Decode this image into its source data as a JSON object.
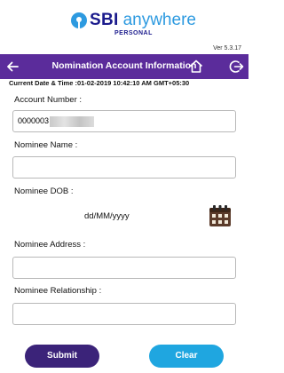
{
  "brand": {
    "sbi": "SBI",
    "anywhere": "anywhere",
    "personal": "PERSONAL"
  },
  "version": "Ver 5.3.17",
  "titlebar": {
    "title": "Nomination Account Information"
  },
  "datetime": "Current Date & Time :01-02-2019 10:42:10 AM GMT+05:30",
  "form": {
    "account_label": "Account Number :",
    "account_value": "0000003",
    "nominee_name_label": "Nominee Name :",
    "nominee_name_value": "",
    "nominee_dob_label": "Nominee DOB :",
    "nominee_dob_placeholder": "dd/MM/yyyy",
    "nominee_address_label": "Nominee Address :",
    "nominee_address_value": "",
    "nominee_relationship_label": "Nominee Relationship :",
    "nominee_relationship_value": ""
  },
  "buttons": {
    "submit": "Submit",
    "clear": "Clear"
  },
  "colors": {
    "header": "#5b2c9b",
    "submit": "#3b2379",
    "clear": "#1fa6e0",
    "brand_blue": "#2d9ae0",
    "brand_navy": "#1a1a8c"
  },
  "icons": {
    "back": "back-arrow-icon",
    "home": "home-icon",
    "logout": "logout-icon",
    "calendar": "calendar-icon",
    "logo": "sbi-logo-icon"
  }
}
